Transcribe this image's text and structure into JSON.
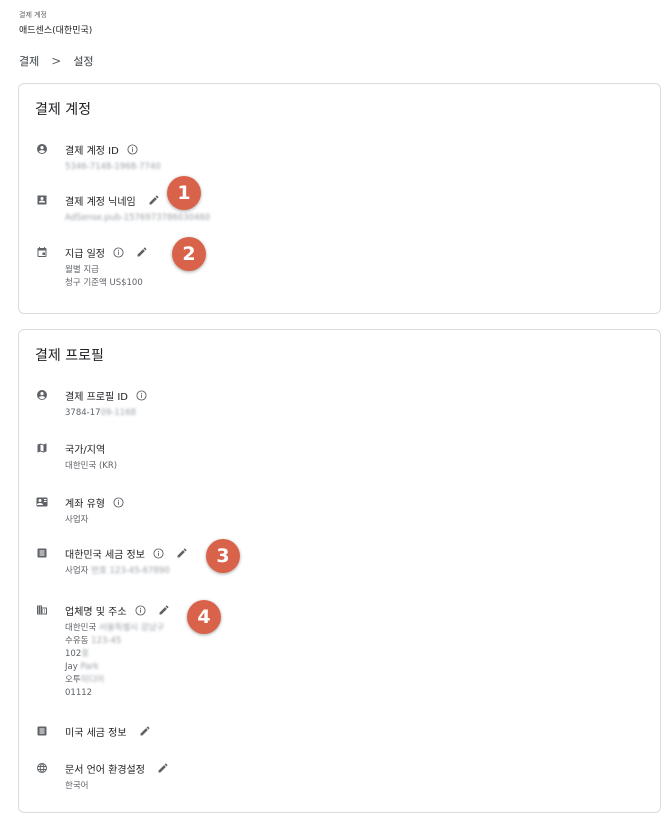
{
  "header": {
    "top_label": "결제 계정",
    "account_name": "애드센스(대한민국)"
  },
  "breadcrumb": {
    "items": [
      "결제",
      "설정"
    ],
    "separator": ">"
  },
  "billing_account": {
    "title": "결제 계정",
    "id": {
      "label": "결제 계정 ID",
      "value": "5346-7148-1968-7740"
    },
    "nickname": {
      "label": "결제 계정 닉네임",
      "value": "AdSense.pub-1576973786030460"
    },
    "payment_schedule": {
      "label": "지급 일정",
      "values": [
        "월별 지급",
        "청구 기준액 US$100"
      ]
    }
  },
  "billing_profile": {
    "title": "결제 프로필",
    "id": {
      "label": "결제 프로필 ID",
      "value_visible": "3784-17",
      "value_hidden": "09-1168"
    },
    "country": {
      "label": "국가/지역",
      "value": "대한민국 (KR)"
    },
    "account_type": {
      "label": "계좌 유형",
      "value": "사업자"
    },
    "kr_tax": {
      "label": "대한민국 세금 정보",
      "value_visible": "사업자 ",
      "value_hidden": "번호 123-45-67890"
    },
    "business": {
      "label": "업체명 및 주소",
      "lines": [
        {
          "visible": "대한민국 ",
          "hidden": "서울특별시 강남구"
        },
        {
          "visible": "수유동 ",
          "hidden": "123-45"
        },
        {
          "visible": "102",
          "hidden": "호"
        },
        {
          "visible": "Jay ",
          "hidden": "Park"
        },
        {
          "visible": "오투",
          "hidden": "미디어"
        },
        {
          "visible": "01112",
          "hidden": ""
        }
      ]
    },
    "us_tax": {
      "label": "미국 세금 정보"
    },
    "doc_language": {
      "label": "문서 언어 환경설정",
      "value": "한국어"
    }
  },
  "markers": [
    "1",
    "2",
    "3",
    "4"
  ],
  "colors": {
    "marker": "#d9634a",
    "icon": "#5f6368",
    "border": "#dadce0"
  }
}
